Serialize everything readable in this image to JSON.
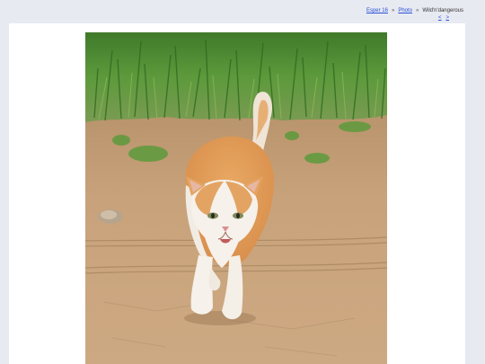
{
  "breadcrumb": {
    "root": "Esper 16",
    "section": "Photo",
    "current": "Wild'n'dangerous",
    "separator": "»"
  },
  "pager": {
    "prev": "<",
    "next": ">"
  },
  "photo": {
    "alt": "Orange and white kitten walking on a dirt road"
  }
}
